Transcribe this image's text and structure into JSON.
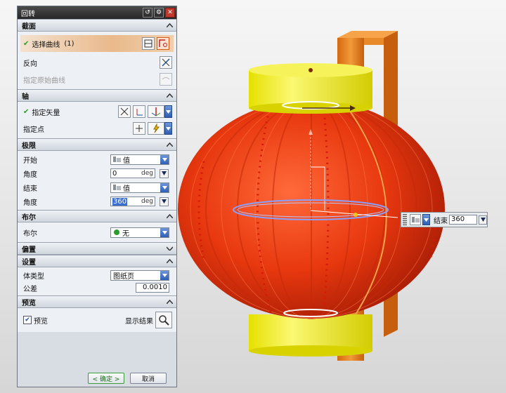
{
  "dialog": {
    "title": "回转",
    "sections": {
      "section": {
        "header": "截面",
        "select_curve_label": "选择曲线",
        "select_curve_count": "(1)",
        "reverse_label": "反向",
        "specify_origin_curve_label": "指定原始曲线"
      },
      "axis": {
        "header": "轴",
        "specify_vector_label": "指定矢量",
        "specify_point_label": "指定点"
      },
      "limits": {
        "header": "极限",
        "start_label": "开始",
        "start_mode": "值",
        "start_angle_label": "角度",
        "start_angle_value": "0",
        "end_label": "结束",
        "end_mode": "值",
        "end_angle_label": "角度",
        "end_angle_value": "360",
        "unit": "deg"
      },
      "boolean": {
        "header": "布尔",
        "boolean_label": "布尔",
        "boolean_value": "无"
      },
      "offset": {
        "header": "偏置"
      },
      "settings": {
        "header": "设置",
        "body_type_label": "体类型",
        "body_type_value": "图纸页",
        "tolerance_label": "公差",
        "tolerance_value": "0.0010"
      },
      "preview": {
        "header": "预览",
        "preview_label": "预览",
        "show_result_label": "显示结果"
      }
    },
    "ok_label": "< 确定 >",
    "cancel_label": "取消"
  },
  "floating_box": {
    "label": "结束",
    "value": "360"
  },
  "colors": {
    "lantern": "#e8380f",
    "cap": "#f2ee1a",
    "post": "#e87f1a",
    "selection": "#e9b98b",
    "accent": "#2f5fb3"
  }
}
